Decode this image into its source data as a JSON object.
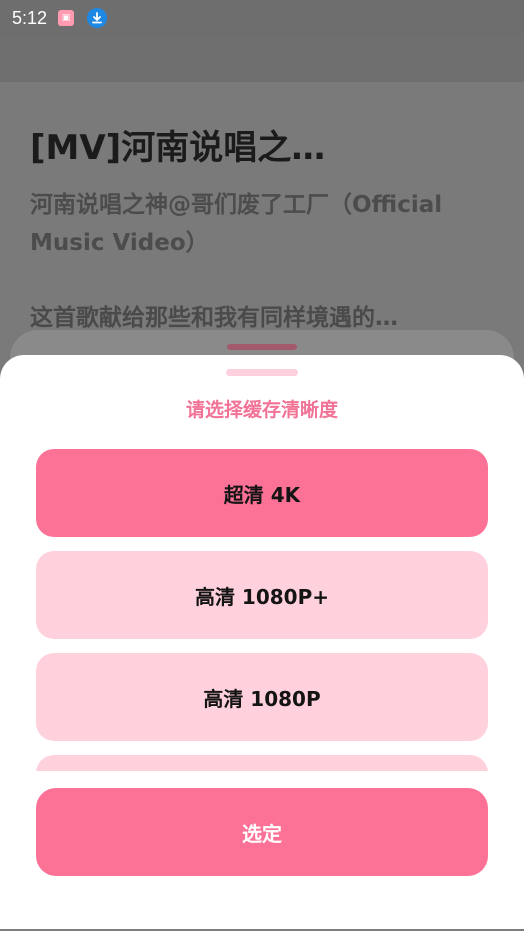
{
  "status_bar": {
    "time": "5:12",
    "notif_app_icon": "bilibili-icon",
    "notif_download_icon": "download-icon"
  },
  "video": {
    "title": "[MV]河南说唱之…",
    "subtitle": "河南说唱之神@哥们废了工厂（Official Music Video）",
    "description": "这首歌献给那些和我有同样境遇的…"
  },
  "sheet": {
    "title": "请选择缓存清晰度",
    "options": [
      {
        "label": "超清 4K",
        "selected": true
      },
      {
        "label": "高清 1080P+",
        "selected": false
      },
      {
        "label": "高清 1080P",
        "selected": false
      },
      {
        "label": "",
        "selected": false
      }
    ],
    "confirm_label": "选定"
  },
  "colors": {
    "accent": "#fc7297",
    "option_bg": "#ffd1dd",
    "title_pink": "#f17497"
  }
}
